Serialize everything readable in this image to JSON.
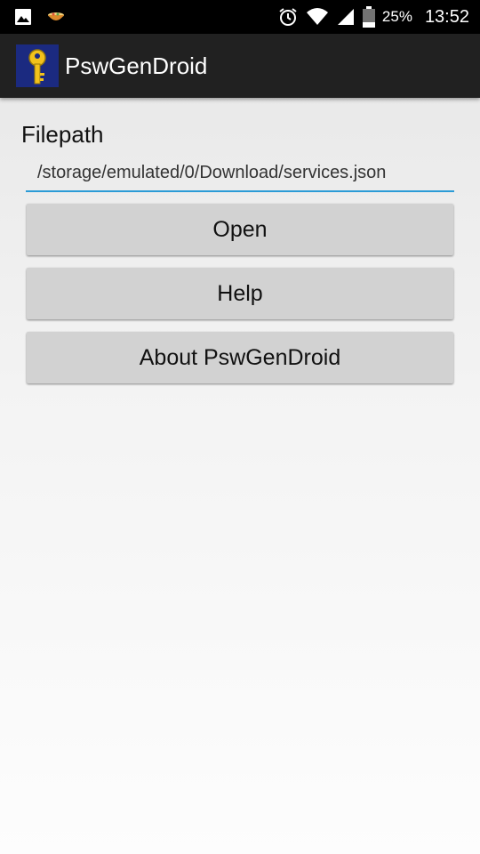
{
  "status_bar": {
    "battery_percent": "25%",
    "time": "13:52",
    "icons": [
      "image-icon",
      "bowl-icon",
      "alarm-icon",
      "wifi-icon",
      "cell-signal-icon",
      "battery-icon"
    ]
  },
  "app_bar": {
    "title": "PswGenDroid",
    "icon": "key-icon",
    "background": "#212121",
    "icon_background": "#1b2a80"
  },
  "main": {
    "filepath_label": "Filepath",
    "filepath_value": "/storage/emulated/0/Download/services.json",
    "open_label": "Open",
    "help_label": "Help",
    "about_label": "About PswGenDroid"
  },
  "colors": {
    "accent": "#2b9bd6",
    "button": "#d2d2d2"
  }
}
